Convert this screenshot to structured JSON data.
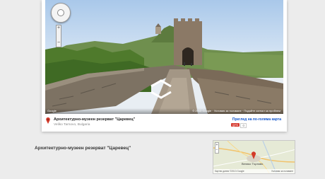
{
  "embed": {
    "place_name": "Архитектурно-музеен резерват \"Царевец\"",
    "place_sub": "Veliko Tarnovo, Bulgaria",
    "bigger_map_link": "Преглед на по-голяма карта",
    "gplus_label": "g+1",
    "gplus_count": "0",
    "footer_left": "Google",
    "footer_right": "© 2013 Google · Условия за ползване · Подайте сигнал за проблем"
  },
  "page": {
    "heading": "Архитектурно-музеен резерват \"Царевец\""
  },
  "mini_map": {
    "town_label": "Велико Търново",
    "footer_left": "Картни данни ©2013 Google",
    "footer_right": "Условия за ползване"
  },
  "colors": {
    "link": "#1155cc",
    "pin": "#d23a2a",
    "page_bg": "#ececec"
  },
  "icons": [
    "compass-nav-icon",
    "zoom-in-icon",
    "zoom-out-icon",
    "location-pin-icon",
    "forward-arrow-icon",
    "back-arrow-icon"
  ]
}
